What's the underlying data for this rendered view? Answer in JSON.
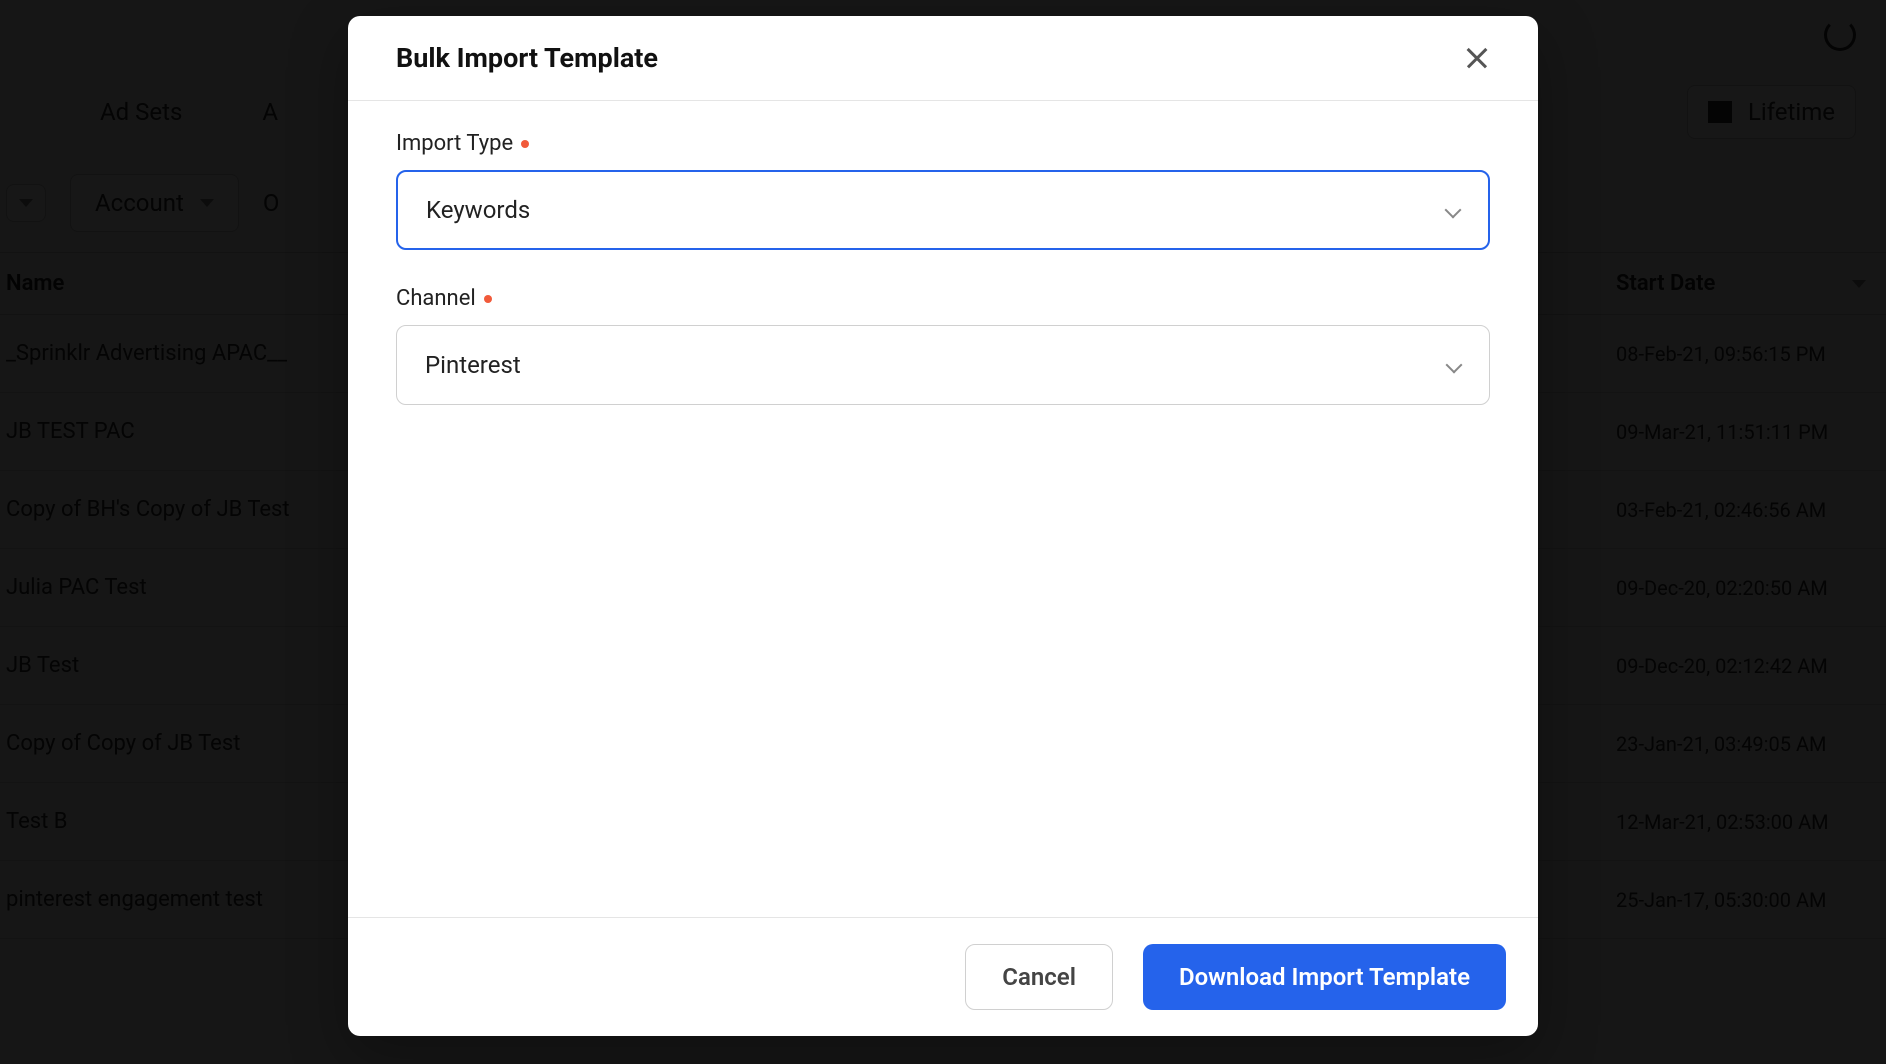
{
  "bg": {
    "tabs": {
      "adsets": "Ad Sets",
      "a": "A",
      "lifetime": "Lifetime"
    },
    "filters": {
      "account": "Account",
      "o": "O"
    },
    "table": {
      "headers": {
        "name": "Name",
        "start_date": "Start Date"
      },
      "rows": [
        {
          "name": "_Sprinklr Advertising APAC__",
          "date": "08-Feb-21, 09:56:15 PM"
        },
        {
          "name": "JB TEST PAC",
          "date": "09-Mar-21, 11:51:11 PM"
        },
        {
          "name": "Copy of BH's Copy of JB Test",
          "date": "03-Feb-21, 02:46:56 AM"
        },
        {
          "name": "Julia PAC Test",
          "date": "09-Dec-20, 02:20:50 AM"
        },
        {
          "name": "JB Test",
          "date": "09-Dec-20, 02:12:42 AM"
        },
        {
          "name": "Copy of Copy of JB Test",
          "date": "23-Jan-21, 03:49:05 AM"
        },
        {
          "name": "Test B",
          "date": "12-Mar-21, 02:53:00 AM"
        },
        {
          "name": "pinterest engagement test",
          "date": "25-Jan-17, 05:30:00 AM"
        }
      ]
    }
  },
  "modal": {
    "title": "Bulk Import Template",
    "import_type_label": "Import Type",
    "import_type_value": "Keywords",
    "channel_label": "Channel",
    "channel_value": "Pinterest",
    "cancel": "Cancel",
    "download": "Download Import Template"
  }
}
